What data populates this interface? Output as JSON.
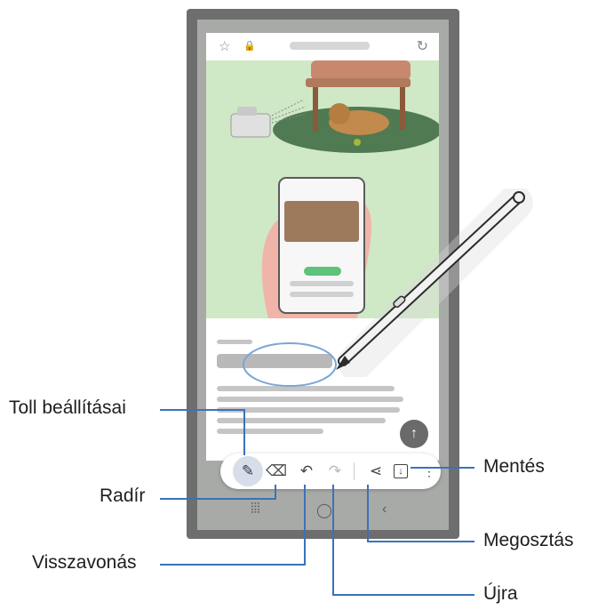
{
  "callouts": {
    "pen_settings": "Toll beállításai",
    "eraser": "Radír",
    "undo": "Visszavonás",
    "save": "Mentés",
    "share": "Megosztás",
    "redo": "Újra"
  },
  "toolbar": {
    "icons": [
      "pen-icon",
      "eraser-icon",
      "undo-icon",
      "redo-icon",
      "share-icon",
      "save-icon"
    ]
  },
  "colors": {
    "leader_line": "#3b72b8",
    "hero_background": "#cfe8c6",
    "handwriting_circle": "#7aa6d8",
    "active_tool": "#d7dee9"
  }
}
